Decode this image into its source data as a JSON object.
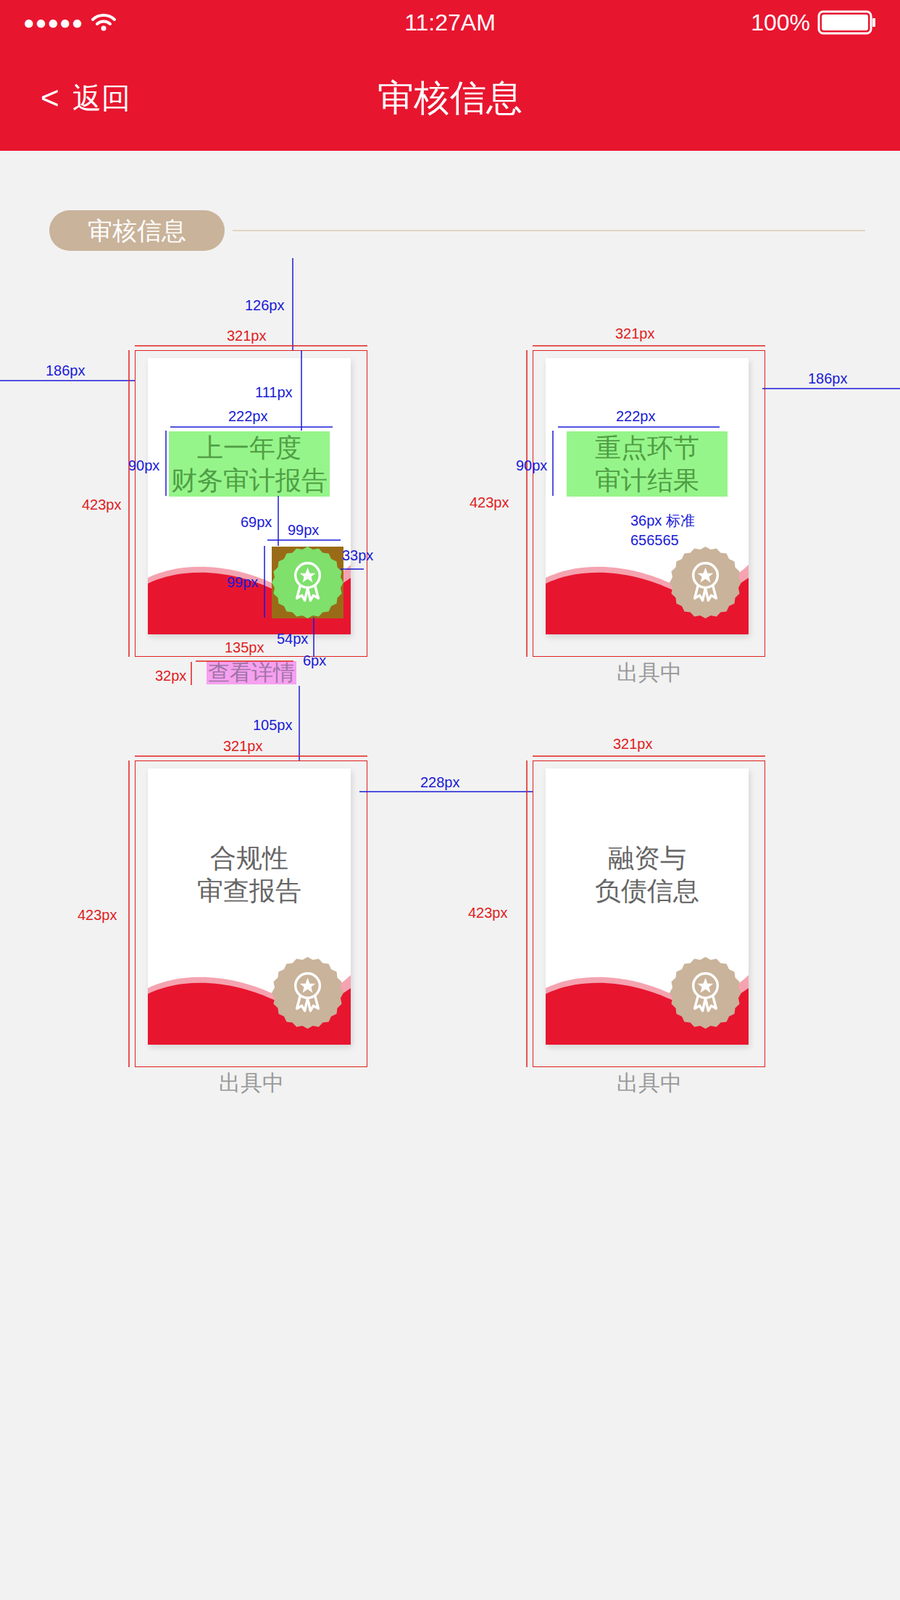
{
  "status_bar": {
    "signal": "●●●●●",
    "time": "11:27AM",
    "battery": "100%"
  },
  "nav": {
    "back_icon": "<",
    "back": "返回",
    "title": "审核信息"
  },
  "section": {
    "title": "审核信息"
  },
  "cards": [
    {
      "title_lines": [
        "上一年度",
        "财务审计报告"
      ],
      "status": "查看详情",
      "title_highlighted": true,
      "medal_highlighted": true,
      "status_highlighted": true
    },
    {
      "title_lines": [
        "重点环节",
        "审计结果"
      ],
      "status": "出具中",
      "title_highlighted": true,
      "medal_highlighted": false,
      "status_highlighted": false
    },
    {
      "title_lines": [
        "合规性",
        "审查报告"
      ],
      "status": "出具中",
      "title_highlighted": false,
      "medal_highlighted": false,
      "status_highlighted": false
    },
    {
      "title_lines": [
        "融资与",
        "负债信息"
      ],
      "status": "出具中",
      "title_highlighted": false,
      "medal_highlighted": false,
      "status_highlighted": false
    }
  ],
  "annotations": [
    {
      "text": "126px",
      "color": "#1a1ad6"
    },
    {
      "text": "321px",
      "color": "#e0201e"
    },
    {
      "text": "186px",
      "color": "#1a1ad6"
    },
    {
      "text": "111px",
      "color": "#1a1ad6"
    },
    {
      "text": "222px",
      "color": "#1a1ad6"
    },
    {
      "text": "90px",
      "color": "#1a1ad6"
    },
    {
      "text": "423px",
      "color": "#e0201e"
    },
    {
      "text": "69px",
      "color": "#1a1ad6"
    },
    {
      "text": "99px",
      "color": "#1a1ad6"
    },
    {
      "text": "33px",
      "color": "#1a1ad6"
    },
    {
      "text": "99px",
      "color": "#1a1ad6"
    },
    {
      "text": "54px",
      "color": "#1a1ad6"
    },
    {
      "text": "135px",
      "color": "#e0201e"
    },
    {
      "text": "6px",
      "color": "#1a1ad6"
    },
    {
      "text": "32px",
      "color": "#e0201e"
    },
    {
      "text": "105px",
      "color": "#1a1ad6"
    },
    {
      "text": "321px",
      "color": "#e0201e"
    },
    {
      "text": "228px",
      "color": "#1a1ad6"
    },
    {
      "text": "423px",
      "color": "#e0201e"
    },
    {
      "text": "321px",
      "color": "#e0201e"
    },
    {
      "text": "186px",
      "color": "#1a1ad6"
    },
    {
      "text": "222px",
      "color": "#1a1ad6"
    },
    {
      "text": "90px",
      "color": "#1a1ad6"
    },
    {
      "text": "423px",
      "color": "#e0201e"
    },
    {
      "text": "36px 标准",
      "color": "#1a1ad6"
    },
    {
      "text": "656565",
      "color": "#1a1ad6"
    },
    {
      "text": "321px",
      "color": "#e0201e"
    },
    {
      "text": "423px",
      "color": "#e0201e"
    }
  ]
}
